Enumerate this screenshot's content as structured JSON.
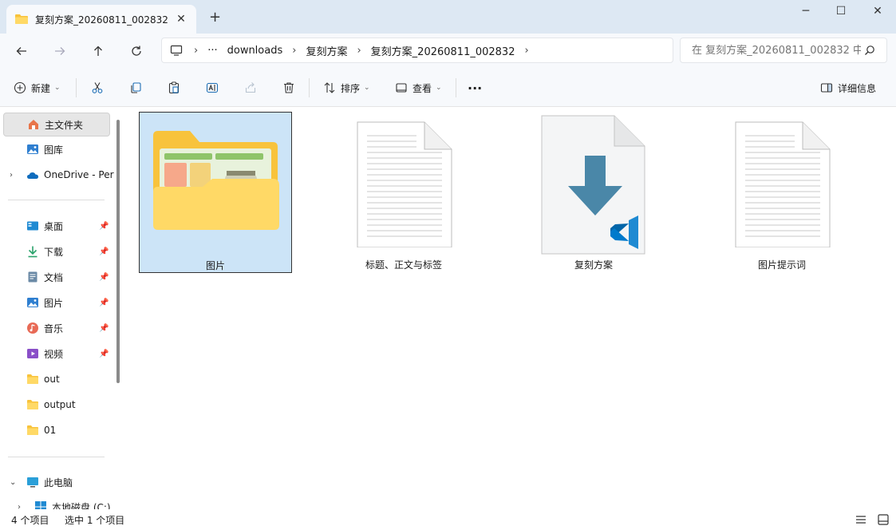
{
  "window": {
    "tab_title": "复刻方案_20260811_002832",
    "tab_close": "✕",
    "new_tab": "+",
    "minimize": "─",
    "maximize": "☐",
    "close": "✕"
  },
  "address": {
    "ellipsis": "···",
    "segments": [
      "downloads",
      "复刻方案",
      "复刻方案_20260811_002832"
    ]
  },
  "search": {
    "placeholder": "在 复刻方案_20260811_002832 中搜索"
  },
  "command_bar": {
    "new_label": "新建",
    "sort_label": "排序",
    "view_label": "查看",
    "more": "···",
    "details_label": "详细信息"
  },
  "sidebar": {
    "home": "主文件夹",
    "gallery": "图库",
    "onedrive": "OneDrive - Per",
    "quick": [
      {
        "label": "桌面",
        "pinned": true
      },
      {
        "label": "下载",
        "pinned": true
      },
      {
        "label": "文档",
        "pinned": true
      },
      {
        "label": "图片",
        "pinned": true
      },
      {
        "label": "音乐",
        "pinned": true
      },
      {
        "label": "视频",
        "pinned": true
      },
      {
        "label": "out",
        "pinned": false
      },
      {
        "label": "output",
        "pinned": false
      },
      {
        "label": "01",
        "pinned": false
      }
    ],
    "this_pc": "此电脑",
    "local_disk": "本地磁盘 (C:)"
  },
  "files": [
    {
      "name": "图片",
      "type": "folder",
      "selected": true
    },
    {
      "name": "标题、正文与标签",
      "type": "text",
      "selected": false
    },
    {
      "name": "复刻方案",
      "type": "vscode",
      "selected": false
    },
    {
      "name": "图片提示词",
      "type": "text",
      "selected": false
    }
  ],
  "status": {
    "item_count": "4 个项目",
    "selection": "选中 1 个项目"
  },
  "colors": {
    "folder_yellow": "#f8c33c",
    "folder_light": "#ffd966",
    "selection_blue": "#cce4f7",
    "vscode_blue": "#1f8ad2",
    "download_arrow": "#4a87a8"
  }
}
